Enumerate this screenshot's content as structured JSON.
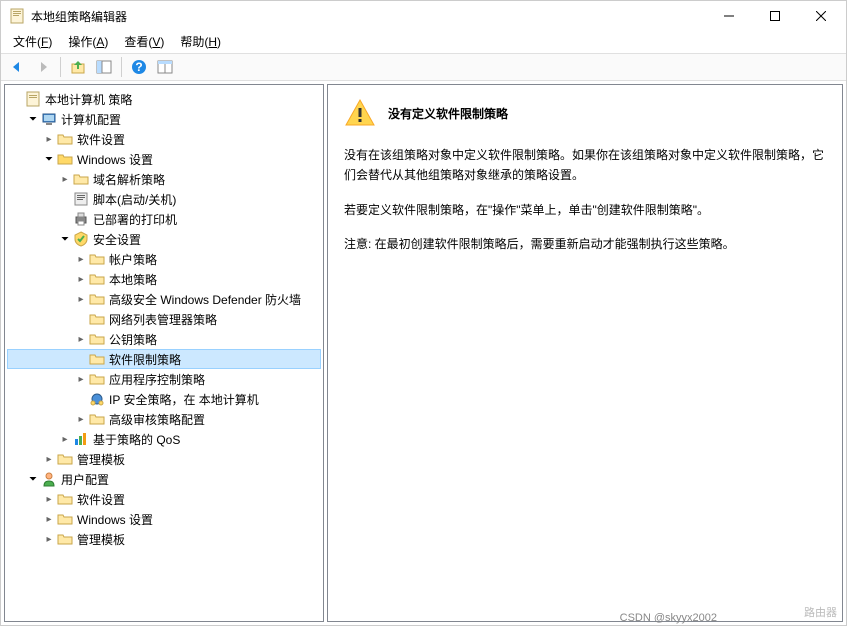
{
  "window": {
    "title": "本地组策略编辑器"
  },
  "menu": {
    "file": "文件(",
    "file_k": "F",
    "file_end": ")",
    "action": "操作(",
    "action_k": "A",
    "action_end": ")",
    "view": "查看(",
    "view_k": "V",
    "view_end": ")",
    "help": "帮助(",
    "help_k": "H",
    "help_end": ")"
  },
  "tree": {
    "root": "本地计算机 策略",
    "computer": "计算机配置",
    "sw_settings": "软件设置",
    "win_settings": "Windows 设置",
    "dns_policy": "域名解析策略",
    "scripts": "脚本(启动/关机)",
    "printers": "已部署的打印机",
    "security": "安全设置",
    "account_policy": "帐户策略",
    "local_policy": "本地策略",
    "defender": "高级安全 Windows Defender 防火墙",
    "network_list": "网络列表管理器策略",
    "public_key": "公钥策略",
    "software_restrict": "软件限制策略",
    "app_control": "应用程序控制策略",
    "ip_security": "IP 安全策略，在 本地计算机",
    "advanced_audit": "高级审核策略配置",
    "qos": "基于策略的 QoS",
    "admin_templates": "管理模板",
    "user": "用户配置",
    "u_sw_settings": "软件设置",
    "u_win_settings": "Windows 设置",
    "u_admin_templates": "管理模板"
  },
  "right_panel": {
    "title": "没有定义软件限制策略",
    "p1": "没有在该组策略对象中定义软件限制策略。如果你在该组策略对象中定义软件限制策略，它们会替代从其他组策略对象继承的策略设置。",
    "p2": "若要定义软件限制策略，在\"操作\"菜单上，单击\"创建软件限制策略\"。",
    "p3": "注意: 在最初创建软件限制策略后，需要重新启动才能强制执行这些策略。"
  },
  "credit": "CSDN @skyyx2002",
  "watermark": "路由器"
}
